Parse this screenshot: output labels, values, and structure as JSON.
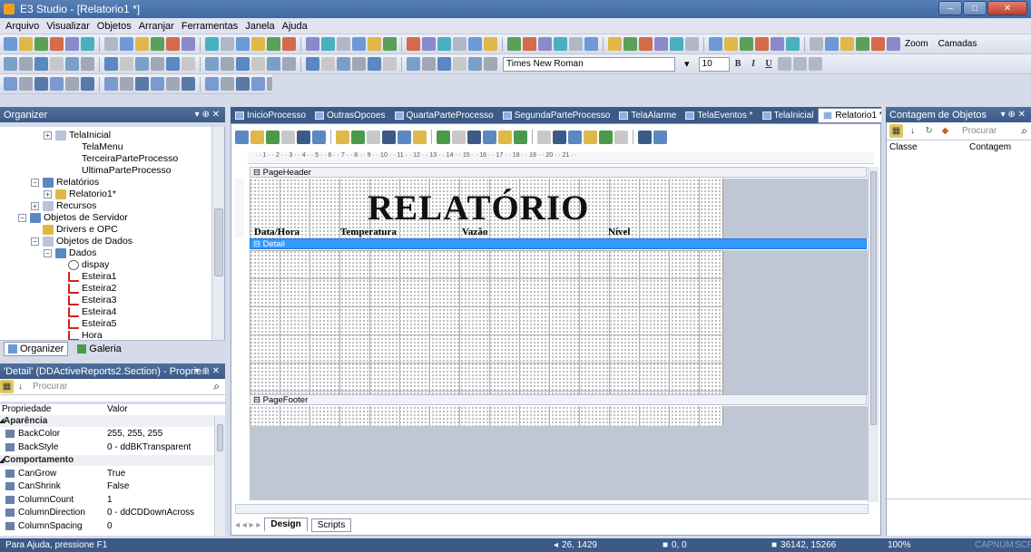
{
  "window": {
    "title": "E3 Studio - [Relatorio1 *]"
  },
  "menu": [
    "Arquivo",
    "Visualizar",
    "Objetos",
    "Arranjar",
    "Ferramentas",
    "Janela",
    "Ajuda"
  ],
  "toolbar": {
    "zoom_label": "Zoom",
    "camadas_label": "Camadas",
    "font_name": "Times New Roman",
    "font_size": "10",
    "bold": "B",
    "italic": "I",
    "underline": "U"
  },
  "organizer": {
    "title": "Organizer",
    "items": [
      {
        "label": "TelaInicial",
        "indent": 3,
        "expand": "+"
      },
      {
        "label": "TelaMenu",
        "indent": 4,
        "expand": ""
      },
      {
        "label": "TerceiraParteProcesso",
        "indent": 4,
        "expand": ""
      },
      {
        "label": "UltimaParteProcesso",
        "indent": 4,
        "expand": ""
      },
      {
        "label": "Relatórios",
        "indent": 2,
        "expand": "−"
      },
      {
        "label": "Relatorio1*",
        "indent": 3,
        "expand": "+"
      },
      {
        "label": "Recursos",
        "indent": 2,
        "expand": "+"
      },
      {
        "label": "Objetos de Servidor",
        "indent": 1,
        "expand": "−"
      },
      {
        "label": "Drivers e OPC",
        "indent": 2,
        "expand": ""
      },
      {
        "label": "Objetos de Dados",
        "indent": 2,
        "expand": "−"
      },
      {
        "label": "Dados",
        "indent": 3,
        "expand": "−"
      },
      {
        "label": "dispay",
        "indent": 4,
        "expand": ""
      },
      {
        "label": "Esteira1",
        "indent": 4,
        "expand": ""
      },
      {
        "label": "Esteira2",
        "indent": 4,
        "expand": ""
      },
      {
        "label": "Esteira3",
        "indent": 4,
        "expand": ""
      },
      {
        "label": "Esteira4",
        "indent": 4,
        "expand": ""
      },
      {
        "label": "Esteira5",
        "indent": 4,
        "expand": ""
      },
      {
        "label": "Hora",
        "indent": 4,
        "expand": ""
      }
    ],
    "tabs": [
      "Organizer",
      "Galeria"
    ]
  },
  "properties": {
    "title": "'Detail' (DDActiveReports2.Section) - Proprie...",
    "search_placeholder": "Procurar",
    "col_prop": "Propriedade",
    "col_val": "Valor",
    "rows": [
      {
        "name": "Aparência",
        "value": "",
        "cat": true
      },
      {
        "name": "BackColor",
        "value": "255, 255, 255",
        "cat": false
      },
      {
        "name": "BackStyle",
        "value": "0 - ddBKTransparent",
        "cat": false
      },
      {
        "name": "Comportamento",
        "value": "",
        "cat": true
      },
      {
        "name": "CanGrow",
        "value": "True",
        "cat": false
      },
      {
        "name": "CanShrink",
        "value": "False",
        "cat": false
      },
      {
        "name": "ColumnCount",
        "value": "1",
        "cat": false
      },
      {
        "name": "ColumnDirection",
        "value": "0 - ddCDDownAcross",
        "cat": false
      },
      {
        "name": "ColumnSpacing",
        "value": "0",
        "cat": false
      }
    ]
  },
  "doc_tabs": [
    "InicioProcesso",
    "OutrasOpcoes",
    "QuartaParteProcesso",
    "SegundaParteProcesso",
    "TelaAlarme",
    "TelaEventos *",
    "TelaInicial",
    "Relatorio1 *"
  ],
  "report": {
    "page_header": "PageHeader",
    "detail": "Detail",
    "page_footer": "PageFooter",
    "title": "RELATÓRIO",
    "col_datahora": "Data/Hora",
    "col_temperatura": "Temperatura",
    "col_vazao": "Vazão",
    "col_nivel": "Nível",
    "ruler": "· · 1 · · 2 · · 3 · · 4 · · 5 · · 6 · · 7 · · 8 · · 9 · · 10 · · 11 · · 12 · · 13 · · 14 · · 15 · · 16 · · 17 · · 18 · · 19 · · 20 · · 21 · ·",
    "bottom_tabs": [
      "Design",
      "Scripts"
    ]
  },
  "object_count": {
    "title": "Contagem de Objetos",
    "search_placeholder": "Procurar",
    "col_class": "Classe",
    "col_count": "Contagem"
  },
  "status": {
    "help": "Para Ajuda, pressione F1",
    "pos": "26, 1429",
    "size": "0, 0",
    "coords": "36142, 15266",
    "zoom": "100%",
    "caps": "CAP",
    "num": "NUM",
    "scrl": "SCR"
  },
  "colors": {
    "accent": "#3c5a86",
    "selection": "#3399ff"
  }
}
